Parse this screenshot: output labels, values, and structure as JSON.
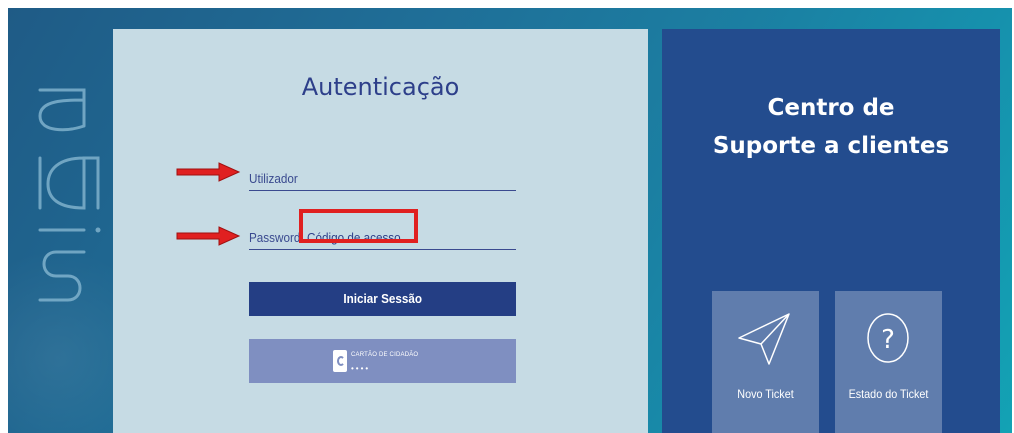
{
  "brand": {
    "logo_text": "siga"
  },
  "login": {
    "title": "Autenticação",
    "username_label": "Utilizador",
    "password_label": "Password",
    "access_code_placeholder": "Código de acesso",
    "submit_label": "Iniciar Sessão",
    "citizen_card_label": "CARTÃO DE CIDADÃO",
    "citizen_card_dots": "••••"
  },
  "support": {
    "title_line1": "Centro de",
    "title_line2": "Suporte a clientes",
    "tiles": [
      {
        "label": "Novo Ticket",
        "icon": "paper-plane-icon"
      },
      {
        "label": "Estado do Ticket",
        "icon": "question-circle-icon"
      }
    ]
  },
  "colors": {
    "accent_dark": "#243e84",
    "panel_light": "#c6dbe4",
    "support_panel": "#234c8e",
    "annotation_red": "#e02020"
  }
}
